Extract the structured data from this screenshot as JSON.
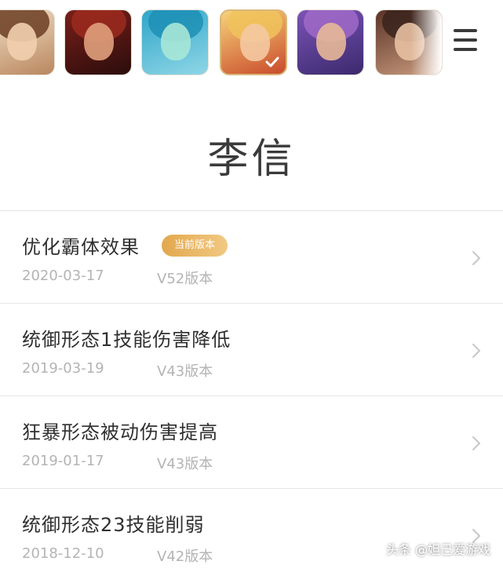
{
  "hero_strip": {
    "heroes": [
      {
        "icon": "hero-portrait-icon",
        "selected": false
      },
      {
        "icon": "hero-portrait-icon",
        "selected": false
      },
      {
        "icon": "hero-portrait-icon",
        "selected": false
      },
      {
        "icon": "hero-portrait-icon",
        "selected": true
      },
      {
        "icon": "hero-portrait-icon",
        "selected": false
      },
      {
        "icon": "hero-portrait-icon",
        "selected": false
      }
    ]
  },
  "header": {
    "hero_name": "李信"
  },
  "changes": [
    {
      "title": "优化霸体效果",
      "badge": "当前版本",
      "date": "2020-03-17",
      "version": "V52版本"
    },
    {
      "title": "统御形态1技能伤害降低",
      "badge": "",
      "date": "2019-03-19",
      "version": "V43版本"
    },
    {
      "title": "狂暴形态被动伤害提高",
      "badge": "",
      "date": "2019-01-17",
      "version": "V43版本"
    },
    {
      "title": "统御形态23技能削弱",
      "badge": "",
      "date": "2018-12-10",
      "version": "V42版本"
    }
  ],
  "watermark": "头条 @妲己爱游戏",
  "colors": {
    "badge_gradient_start": "#e2a84d",
    "badge_gradient_end": "#f1c983",
    "selected_border": "#d9b77a",
    "meta_text": "#b4b4b4"
  }
}
